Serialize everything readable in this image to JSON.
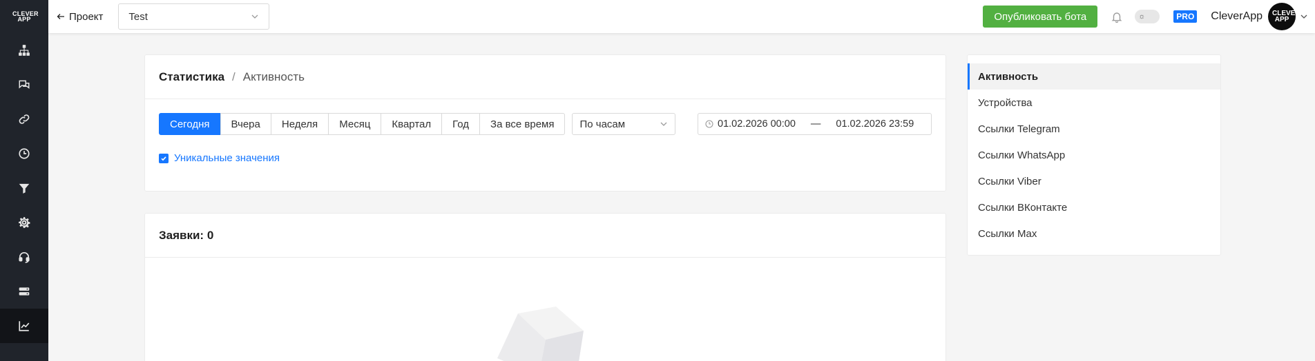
{
  "sidebar": {
    "logo": "CLEVER APP",
    "items": [
      {
        "icon": "sitemap-icon"
      },
      {
        "icon": "chat-icon"
      },
      {
        "icon": "link-icon"
      },
      {
        "icon": "clock-icon"
      },
      {
        "icon": "funnel-icon"
      },
      {
        "icon": "gear-icon"
      },
      {
        "icon": "headset-icon"
      },
      {
        "icon": "server-icon"
      },
      {
        "icon": "chart-line-icon",
        "active": true
      }
    ]
  },
  "topbar": {
    "back_label": "Проект",
    "project_value": "Test",
    "publish_label": "Опубликовать бота",
    "pro_label": "PRO",
    "username": "CleverApp",
    "avatar_text": "CLEVER APP"
  },
  "activity_card": {
    "breadcrumb_root": "Статистика",
    "breadcrumb_sep": "/",
    "breadcrumb_current": "Активность",
    "periods": [
      "Сегодня",
      "Вчера",
      "Неделя",
      "Месяц",
      "Квартал",
      "Год",
      "За все время"
    ],
    "active_period": "Сегодня",
    "group_by_value": "По часам",
    "date_from": "01.02.2026 00:00",
    "date_sep": "—",
    "date_to": "01.02.2026 23:59",
    "unique_label": "Уникальные значения",
    "unique_checked": true
  },
  "requests_card": {
    "title": "Заявки: 0"
  },
  "side_menu": {
    "items": [
      "Активность",
      "Устройства",
      "Ссылки Telegram",
      "Ссылки WhatsApp",
      "Ссылки Viber",
      "Ссылки ВКонтакте",
      "Ссылки Max"
    ],
    "active": "Активность"
  },
  "colors": {
    "accent": "#1677ff",
    "publish": "#52b041",
    "sidebar_bg": "#20242b"
  }
}
